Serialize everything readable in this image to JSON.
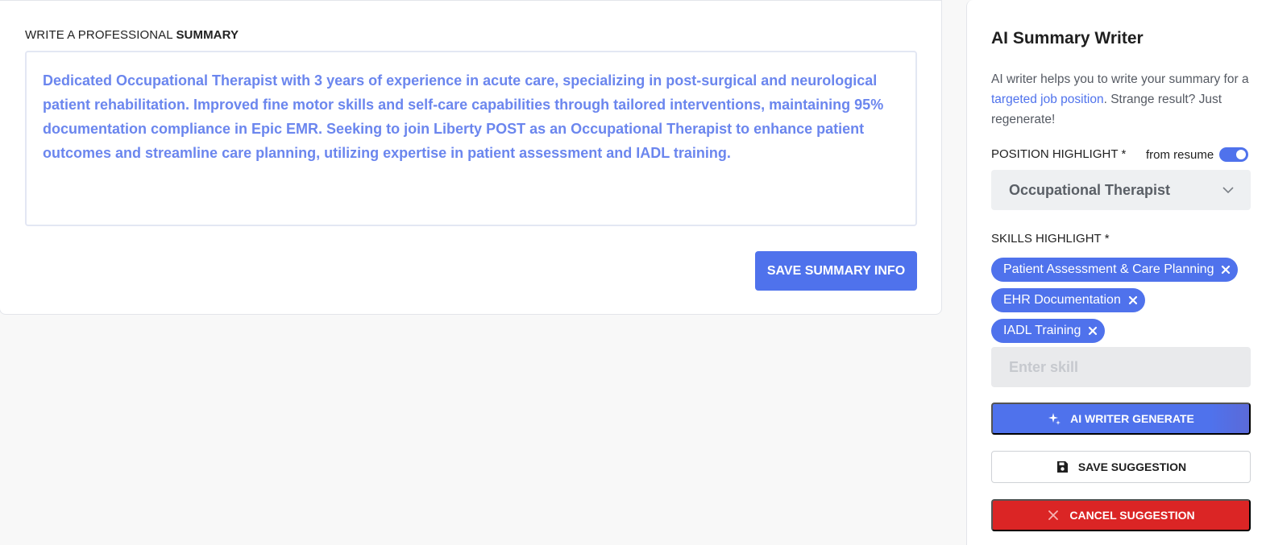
{
  "summary": {
    "heading_prefix": "WRITE A PROFESSIONAL",
    "heading_bold": "SUMMARY",
    "text": "Dedicated Occupational Therapist with 3 years of experience in acute care, specializing in post-surgical and neurological patient rehabilitation. Improved fine motor skills and self-care capabilities through tailored interventions, maintaining 95% documentation compliance in Epic EMR. Seeking to join Liberty POST as an Occupational Therapist to enhance patient outcomes and streamline care planning, utilizing expertise in patient assessment and IADL training.",
    "save_label": "SAVE SUMMARY INFO"
  },
  "ai": {
    "title": "AI Summary Writer",
    "desc_before": "AI writer helps you to write your summary for a ",
    "desc_link": "targeted job position",
    "desc_after": ". Strange result? Just regenerate!",
    "position_label": "POSITION HIGHLIGHT",
    "required_mark": "*",
    "from_resume_label": "from resume",
    "from_resume_on": true,
    "position_value": "Occupational Therapist",
    "skills_label": "SKILLS HIGHLIGHT",
    "skills": [
      "Patient Assessment & Care Planning",
      "EHR Documentation",
      "IADL Training"
    ],
    "skill_placeholder": "Enter skill",
    "generate_label": "AI WRITER GENERATE",
    "save_suggestion_label": "SAVE SUGGESTION",
    "cancel_suggestion_label": "CANCEL SUGGESTION"
  },
  "colors": {
    "accent": "#4f72ec",
    "danger": "#db2525",
    "summary_text": "#6b86ee"
  }
}
